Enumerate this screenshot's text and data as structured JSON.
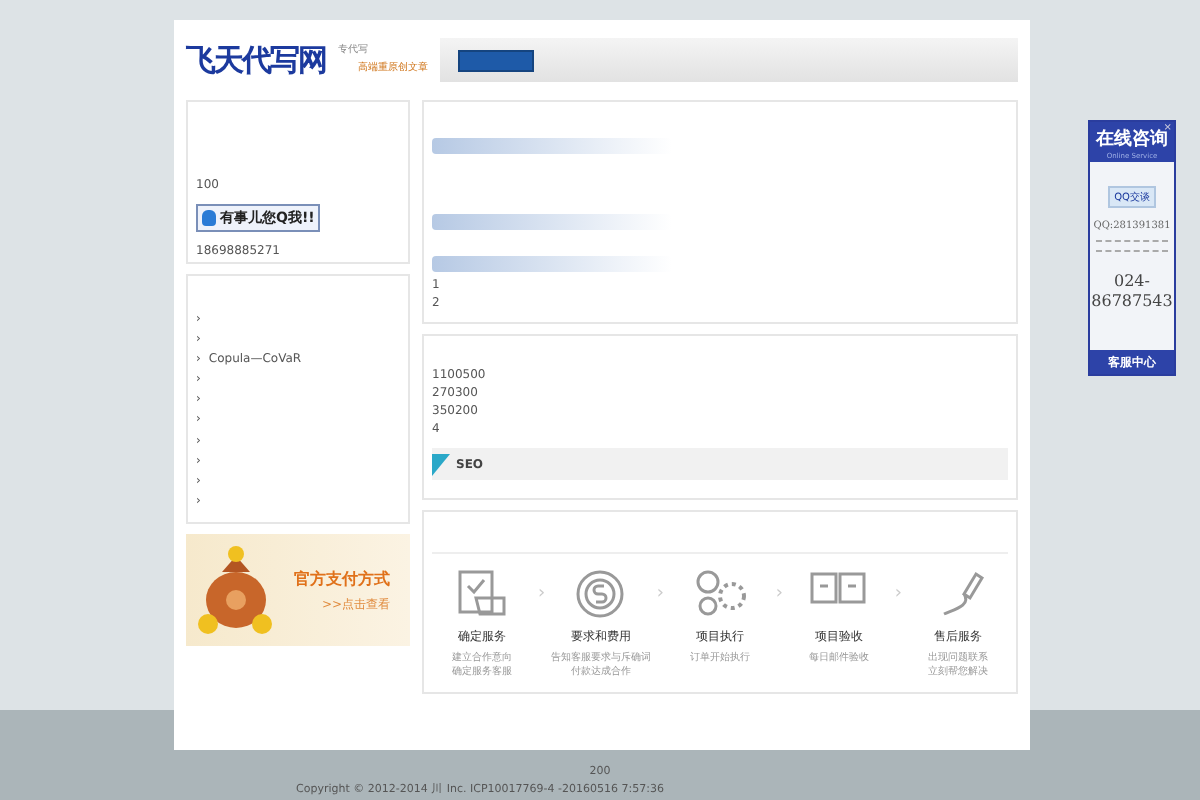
{
  "header": {
    "logo": "飞天代写网",
    "tagline_1": "专代写",
    "tagline_2": "高端重原创文章"
  },
  "contact_box": {
    "count": "100",
    "qq_button": "有事儿您Q我!!",
    "phone": "18698885271"
  },
  "link_list": {
    "items": [
      {
        "bullet": "›"
      },
      {
        "bullet": "›"
      },
      {
        "bullet": "›",
        "label": "Copula—CoVaR"
      },
      {
        "bullet": "›"
      },
      {
        "bullet": "›"
      },
      {
        "bullet": "›"
      },
      {
        "bullet": "›"
      },
      {
        "bullet": "›"
      },
      {
        "bullet": "›"
      },
      {
        "bullet": "›"
      }
    ]
  },
  "pay_banner": {
    "title": "官方支付方式",
    "link": ">>点击查看"
  },
  "section_1": {
    "lines": [
      "1",
      "2"
    ]
  },
  "section_2": {
    "lines": [
      "1100500",
      "270300",
      "350200",
      "4"
    ],
    "tag_bar": "SEO"
  },
  "process": {
    "arrows": [
      "›",
      "›",
      "›",
      "›"
    ],
    "steps": [
      {
        "title": "确定服务",
        "desc": [
          "建立合作意向",
          "确定服务客服"
        ]
      },
      {
        "title": "要求和费用",
        "desc": [
          "告知客服要求与斥确词",
          "付款达成合作"
        ]
      },
      {
        "title": "项目执行",
        "desc": [
          "订单开始执行"
        ]
      },
      {
        "title": "项目验收",
        "desc": [
          "每日邮件验收"
        ]
      },
      {
        "title": "售后服务",
        "desc": [
          "出现问题联系",
          "立刻帮您解决"
        ]
      }
    ]
  },
  "float_widget": {
    "title": "在线咨询",
    "subtitle": "Online Service",
    "close": "×",
    "qq_button": "QQ交谈",
    "qq": "QQ:281391381",
    "phone": "024-86787543",
    "footer": "客服中心"
  },
  "footer": {
    "count": "200",
    "copyright": "Copyright © 2012-2014 川 Inc. ICP10017769-4 -20160516 7:57:36"
  }
}
